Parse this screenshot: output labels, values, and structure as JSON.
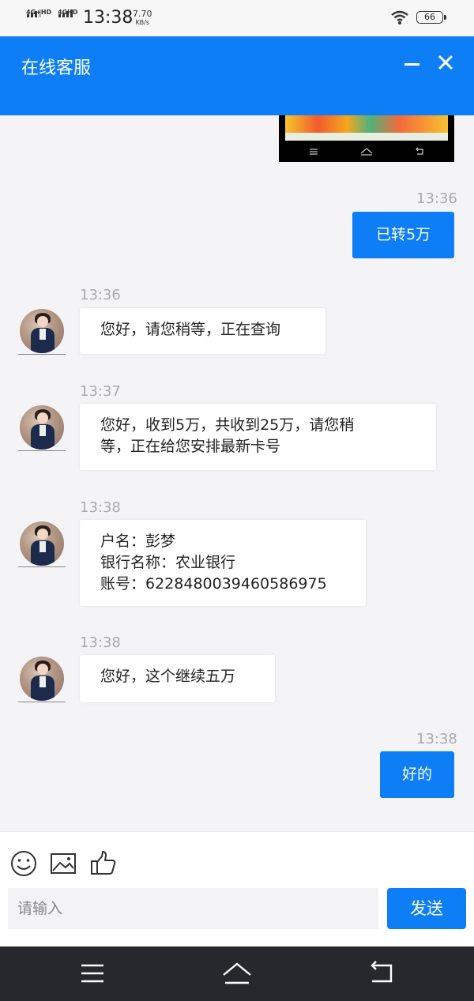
{
  "status_bar": {
    "network1": "4G+HD",
    "network2": "4GHD",
    "time": "13:38",
    "speed_value": "7.70",
    "speed_unit": "KB/s",
    "battery": "66"
  },
  "header": {
    "title": "在线客服",
    "background_color": "#0d7ef5"
  },
  "messages": [
    {
      "direction": "out",
      "time": "13:36",
      "text": "已转5万"
    },
    {
      "direction": "in",
      "time": "13:36",
      "lines": [
        "您好，请您稍等，正在查询"
      ]
    },
    {
      "direction": "in",
      "time": "13:37",
      "lines": [
        "您好，收到5万，共收到25万，请您稍",
        "等，正在给您安排最新卡号"
      ]
    },
    {
      "direction": "in",
      "time": "13:38",
      "lines": [
        "户名：彭梦",
        "银行名称：农业银行",
        "账号：6228480039460586975"
      ]
    },
    {
      "direction": "in",
      "time": "13:38",
      "lines": [
        "您好，这个继续五万"
      ]
    },
    {
      "direction": "out",
      "time": "13:38",
      "text": "好的"
    }
  ],
  "composer": {
    "placeholder": "请输入",
    "send_label": "发送",
    "tools": [
      "smiley-icon",
      "image-icon",
      "thumbs-up-icon"
    ]
  },
  "colors": {
    "accent": "#0d7ef5",
    "background": "#f4f4f6",
    "navbar": "#25292e"
  }
}
